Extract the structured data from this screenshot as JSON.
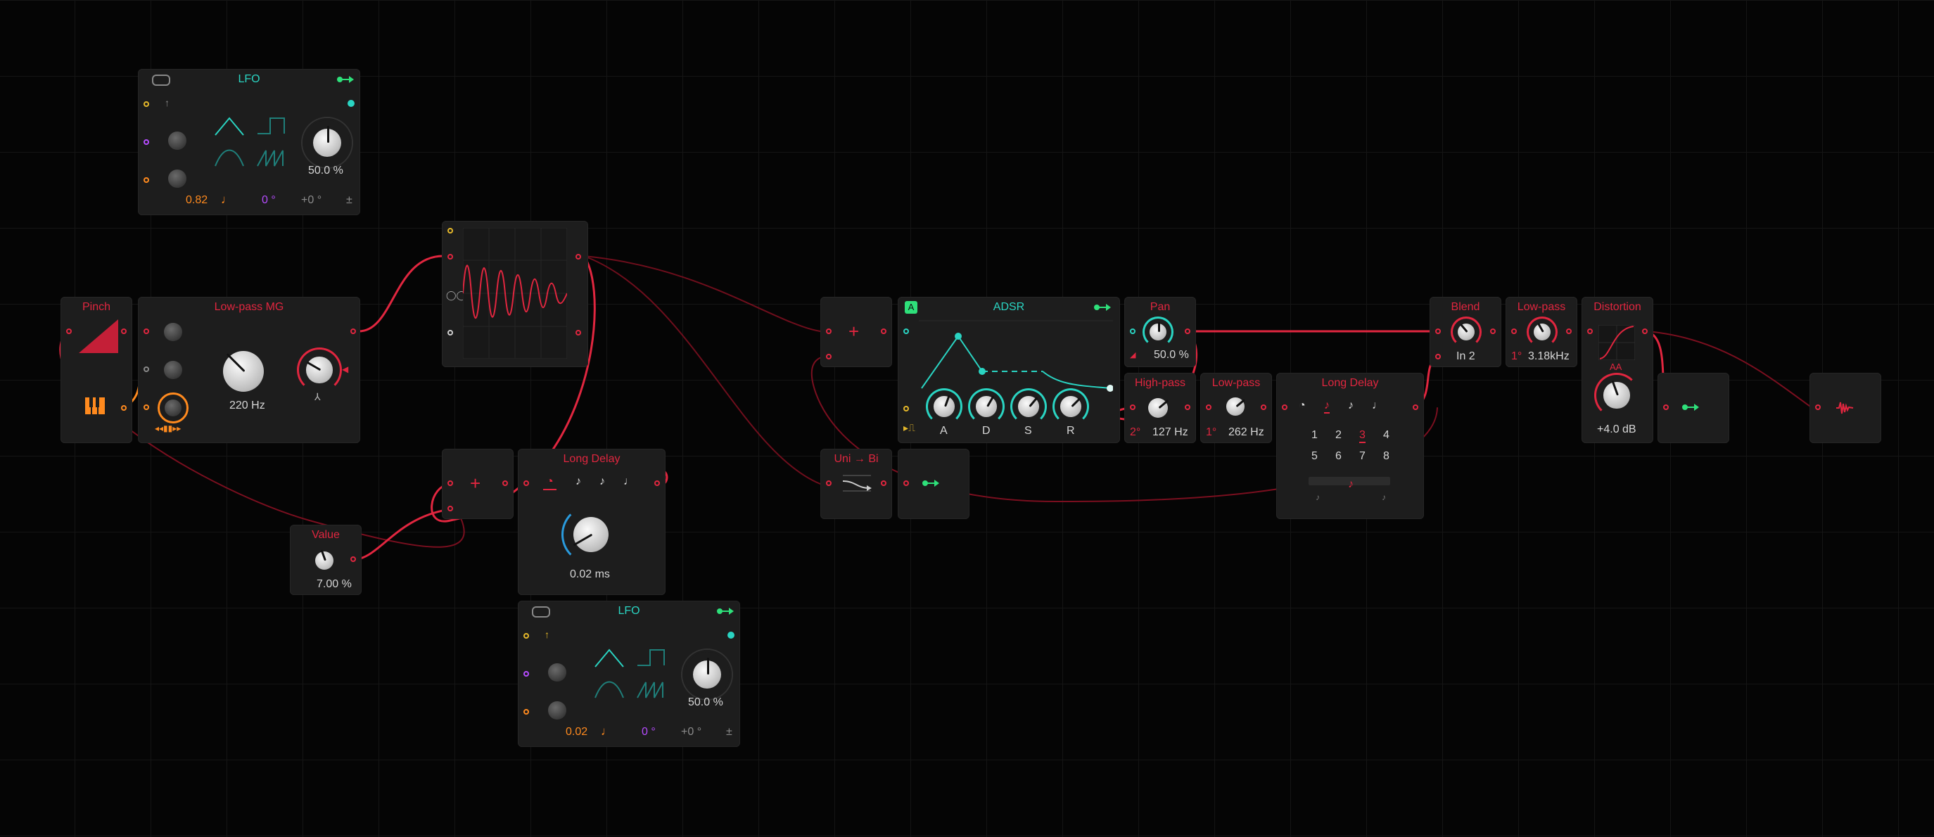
{
  "lfo_top": {
    "title": "LFO",
    "rate": "0.82",
    "phase": "0 °",
    "offset": "+0 °",
    "amount": "50.0 %",
    "pm": "±"
  },
  "pinch": {
    "title": "Pinch"
  },
  "lowpass_mg": {
    "title": "Low-pass MG",
    "cutoff": "220 Hz"
  },
  "plus_top": {
    "symbol": "+"
  },
  "plus_bottom": {
    "symbol": "+"
  },
  "adsr": {
    "title": "ADSR",
    "badge": "A",
    "labels": [
      "A",
      "D",
      "S",
      "R"
    ]
  },
  "pan": {
    "title": "Pan",
    "value": "50.0 %"
  },
  "highpass": {
    "title": "High-pass",
    "order": "2°",
    "value": "127 Hz"
  },
  "lowpass_small": {
    "title": "Low-pass",
    "order": "1°",
    "value": "262 Hz"
  },
  "long_delay_right": {
    "title": "Long Delay",
    "numbers": [
      "1",
      "2",
      "3",
      "4",
      "5",
      "6",
      "7",
      "8"
    ]
  },
  "blend": {
    "title": "Blend",
    "value": "In 2"
  },
  "lowpass_right": {
    "title": "Low-pass",
    "order": "1°",
    "value": "3.18kHz"
  },
  "distortion": {
    "title": "Distortion",
    "aa": "AA",
    "value": "+4.0 dB"
  },
  "uni_bi": {
    "title": "Uni → Bi"
  },
  "long_delay_mid": {
    "title": "Long Delay",
    "value": "0.02 ms"
  },
  "value_mod": {
    "title": "Value",
    "value": "7.00 %"
  },
  "lfo_bottom": {
    "title": "LFO",
    "rate": "0.02",
    "phase": "0 °",
    "offset": "+0 °",
    "amount": "50.0 %",
    "pm": "±"
  },
  "colors": {
    "accent": "#e0263f",
    "teal": "#2ad4c2",
    "green": "#2ee07a",
    "orange": "#ff8a1e",
    "purple": "#b64cff",
    "background": "#050505"
  }
}
